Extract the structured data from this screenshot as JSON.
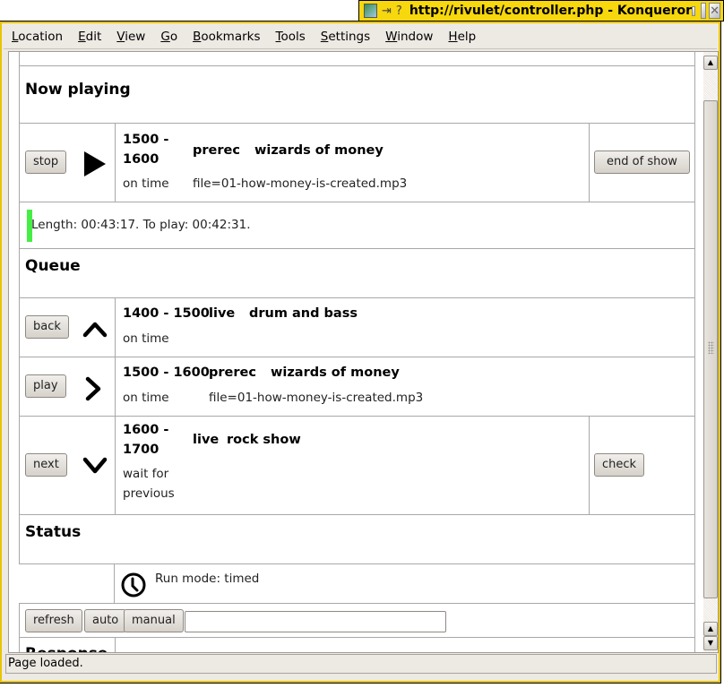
{
  "window": {
    "title": "http://rivulet/controller.php - Konqueror",
    "status": "Page loaded."
  },
  "menu": [
    "Location",
    "Edit",
    "View",
    "Go",
    "Bookmarks",
    "Tools",
    "Settings",
    "Window",
    "Help"
  ],
  "menu_accel": [
    "L",
    "E",
    "V",
    "G",
    "B",
    "T",
    "S",
    "W",
    "H"
  ],
  "now_playing": {
    "heading": "Now playing",
    "stop_label": "stop",
    "time_line1": "1500 -",
    "time_line2": "1600",
    "type": "prerec",
    "title": "wizards of money",
    "timing": "on time",
    "file": "file=01-how-money-is-created.mp3",
    "end_label": "end of show",
    "progress_text": "Length: 00:43:17. To play: 00:42:31.",
    "indicator_color": "#44ee44"
  },
  "queue": {
    "heading": "Queue",
    "items": [
      {
        "button": "back",
        "icon": "chevron-up",
        "time": "1400 - 1500",
        "type": "live",
        "title": "drum and bass",
        "timing": "on time",
        "file": ""
      },
      {
        "button": "play",
        "icon": "chevron-right",
        "time": "1500 - 1600",
        "type": "prerec",
        "title": "wizards of money",
        "timing": "on time",
        "file": "file=01-how-money-is-created.mp3"
      },
      {
        "button": "next",
        "icon": "chevron-down",
        "time_line1": "1600 -",
        "time_line2": "1700",
        "type": "live",
        "title": "rock show",
        "timing_line1": "wait for",
        "timing_line2": "previous",
        "action": "check"
      }
    ]
  },
  "status": {
    "heading": "Status",
    "run_mode": "Run mode: timed"
  },
  "controls": {
    "refresh": "refresh",
    "auto": "auto",
    "manual": "manual",
    "input_value": ""
  },
  "response": {
    "heading": "Response"
  }
}
